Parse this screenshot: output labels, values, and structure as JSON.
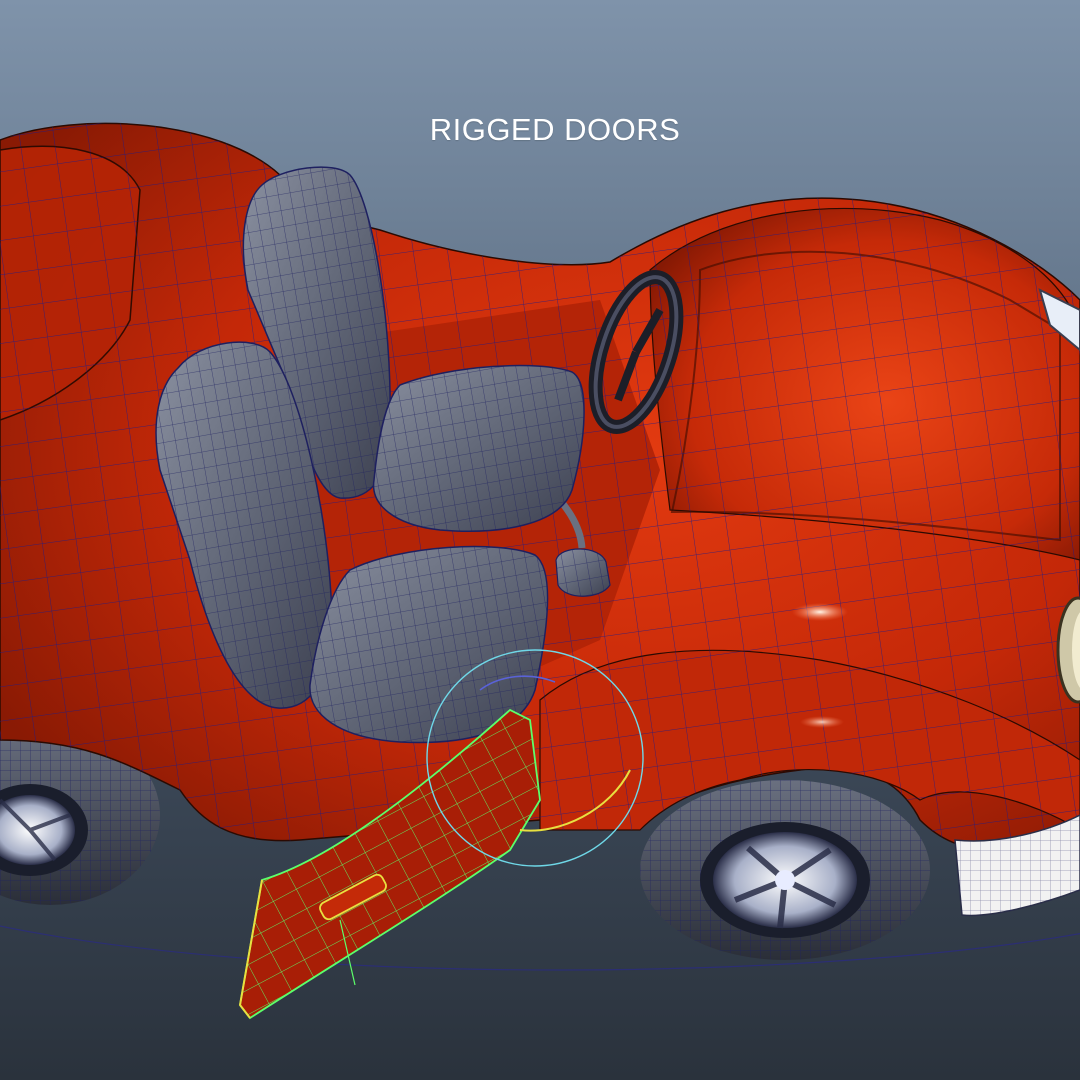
{
  "viewport": {
    "caption": "RIGGED DOORS",
    "background_top": "#7f93aa",
    "background_bottom": "#2a323c"
  },
  "model": {
    "body_color": "#c82a08",
    "wire_color": "#1a1a8c",
    "seat_color": "#5a6070",
    "selection_wire_color": "#5cff6a",
    "pivot_ring_color": "#6fd8e8",
    "pivot_arc_color": "#e8e040",
    "bumper_color": "#f2f2f2"
  }
}
